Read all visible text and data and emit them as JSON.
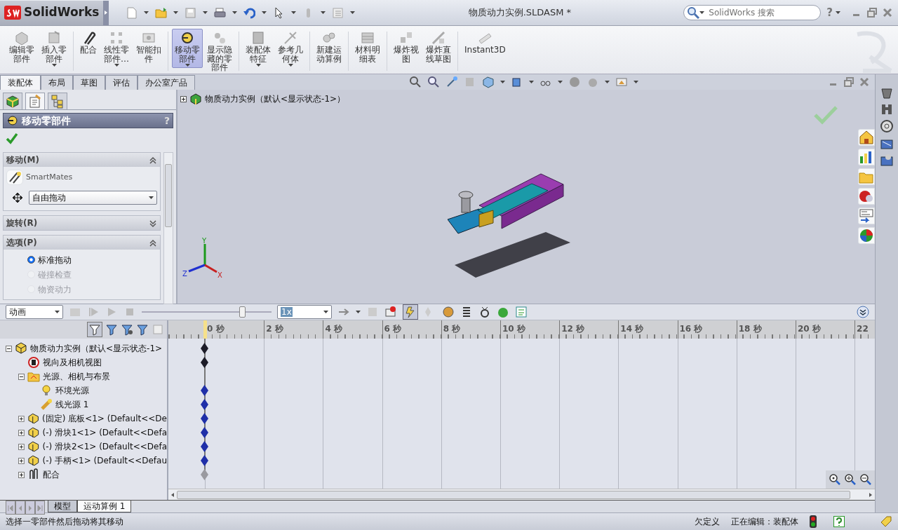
{
  "window": {
    "app_name": "SolidWorks",
    "title": "物质动力实例.SLDASM *",
    "search_placeholder": "SolidWorks 搜索",
    "help": "?"
  },
  "command_buttons": [
    {
      "label_lines": [
        "编辑零",
        "部件"
      ],
      "selected": false,
      "has_menu": false
    },
    {
      "label_lines": [
        "插入零",
        "部件"
      ],
      "selected": false,
      "has_menu": true
    },
    {
      "label_lines": [
        "配合"
      ],
      "selected": false,
      "has_menu": false
    },
    {
      "label_lines": [
        "线性零",
        "部件…"
      ],
      "selected": false,
      "has_menu": true
    },
    {
      "label_lines": [
        "智能扣",
        "件"
      ],
      "selected": false,
      "has_menu": false
    },
    {
      "label_lines": [
        "移动零",
        "部件"
      ],
      "selected": true,
      "has_menu": true
    },
    {
      "label_lines": [
        "显示隐",
        "藏的零",
        "部件"
      ],
      "selected": false,
      "has_menu": false
    },
    {
      "label_lines": [
        "装配体",
        "特征"
      ],
      "selected": false,
      "has_menu": true
    },
    {
      "label_lines": [
        "参考几",
        "何体"
      ],
      "selected": false,
      "has_menu": true
    },
    {
      "label_lines": [
        "新建运",
        "动算例"
      ],
      "selected": false,
      "has_menu": false
    },
    {
      "label_lines": [
        "材料明",
        "细表"
      ],
      "selected": false,
      "has_menu": false
    },
    {
      "label_lines": [
        "爆炸视",
        "图"
      ],
      "selected": false,
      "has_menu": false
    },
    {
      "label_lines": [
        "爆炸直",
        "线草图"
      ],
      "selected": false,
      "has_menu": false
    },
    {
      "label_lines": [
        "Instant3D"
      ],
      "selected": false,
      "has_menu": false
    }
  ],
  "ribbon_tabs": [
    {
      "label": "装配体",
      "selected": true
    },
    {
      "label": "布局",
      "selected": false
    },
    {
      "label": "草图",
      "selected": false
    },
    {
      "label": "评估",
      "selected": false
    },
    {
      "label": "办公室产品",
      "selected": false
    }
  ],
  "left_panel": {
    "tabs": [
      {
        "selected": false
      },
      {
        "selected": true
      },
      {
        "selected": false
      }
    ],
    "title": "移动零部件",
    "help": "?",
    "sections": [
      {
        "kind": "move",
        "title": "移动(M)",
        "expanded": true,
        "smartmates": "SmartMates",
        "mode": "自由拖动"
      },
      {
        "title": "旋转(R)",
        "expanded": false
      },
      {
        "kind": "options",
        "title": "选项(P)",
        "expanded": true,
        "options": [
          {
            "label": "标准拖动",
            "selected": true,
            "disabled": false
          },
          {
            "label": "碰撞检查",
            "selected": false,
            "disabled": true
          },
          {
            "label": "物资动力",
            "selected": false,
            "disabled": true
          }
        ]
      }
    ]
  },
  "graphics": {
    "tree_root": "物质动力实例（默认<显示状态-1>）",
    "axes": {
      "y": "Y",
      "z": "Z",
      "x": "X"
    }
  },
  "motion_study": {
    "study_type": "动画",
    "slider": {
      "level": 0.79
    },
    "speed": "1x",
    "ruler": [
      "0 秒",
      "2 秒",
      "4 秒",
      "6 秒",
      "8 秒",
      "10 秒",
      "12 秒",
      "14 秒",
      "16 秒",
      "18 秒",
      "20 秒",
      "22"
    ],
    "tree": [
      {
        "kind": "assembly",
        "label": "物质动力实例（默认<显示状态-1>",
        "expanded": true,
        "color": "#1c1c28",
        "children": [
          {
            "kind": "camera",
            "label": "视向及相机视图",
            "color": "#1c1c28"
          },
          {
            "kind": "folder",
            "label": "光源、相机与布景",
            "expanded": true,
            "children": [
              {
                "kind": "bulb",
                "label": "环境光源",
                "color": "#1f2fa8"
              },
              {
                "kind": "spotlight",
                "label": "线光源 1",
                "color": "#1f2fa8"
              }
            ]
          },
          {
            "kind": "part",
            "label": "(固定) 底板<1> (Default<<De",
            "expanded": false,
            "color": "#1f2fa8"
          },
          {
            "kind": "part",
            "label": "(-) 滑块1<1> (Default<<Defa",
            "expanded": false,
            "color": "#1f2fa8"
          },
          {
            "kind": "part",
            "label": "(-) 滑块2<1> (Default<<Defa",
            "expanded": false,
            "color": "#1f2fa8"
          },
          {
            "kind": "part",
            "label": "(-) 手柄<1> (Default<<Defau",
            "expanded": false,
            "color": "#1f2fa8"
          },
          {
            "kind": "mates",
            "label": "配合",
            "expanded": false,
            "color": "#9a9aa0"
          }
        ]
      }
    ]
  },
  "bottom_tabs": [
    {
      "label": "模型",
      "selected": false
    },
    {
      "label": "运动算例 1",
      "selected": true
    }
  ],
  "status_bar": {
    "message": "选择一零部件然后拖动将其移动",
    "fields": [
      "欠定义",
      "正在编辑：装配体"
    ]
  }
}
